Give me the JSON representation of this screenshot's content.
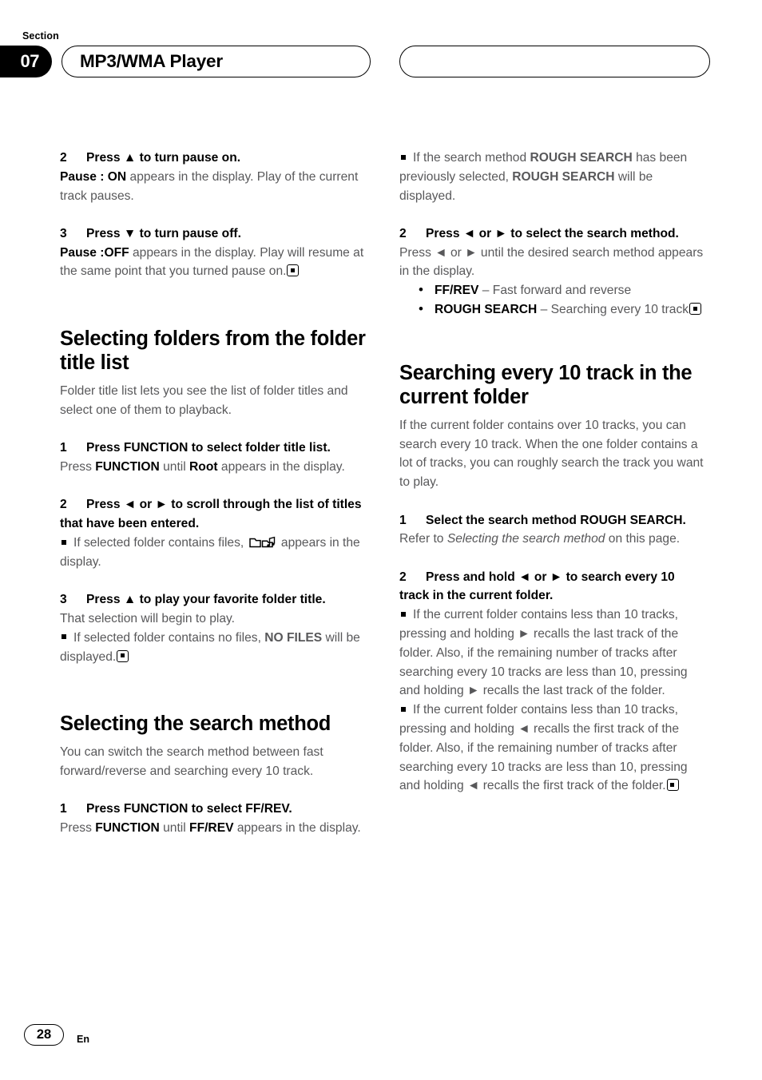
{
  "header": {
    "section_label": "Section",
    "section_number": "07",
    "title": "MP3/WMA Player",
    "right_pill_title": ""
  },
  "footer": {
    "page_number": "28",
    "language": "En"
  },
  "left_column": {
    "step2": {
      "num": "2",
      "title": "Press ▲ to turn pause on.",
      "body_bold": "Pause : ON",
      "body_rest": " appears in the display. Play of the current track pauses."
    },
    "step3": {
      "num": "3",
      "title": "Press ▼ to turn pause off.",
      "body_bold": "Pause :OFF",
      "body_rest": " appears in the display. Play will resume at the same point that you turned pause on."
    },
    "heading_folders": "Selecting folders from the folder title list",
    "folders_intro": "Folder title list lets you see the list of folder titles and select one of them to playback.",
    "folders_step1": {
      "num": "1",
      "title": "Press FUNCTION to select folder title list.",
      "body_pre": "Press ",
      "body_b1": "FUNCTION",
      "body_mid": " until ",
      "body_b2": "Root",
      "body_post": " appears in the display."
    },
    "folders_step2": {
      "num": "2",
      "title": "Press ◄ or ► to scroll through the list of titles that have been entered.",
      "note_pre": "If selected folder contains files, ",
      "note_post": " appears in the display."
    },
    "folders_step3": {
      "num": "3",
      "title": "Press ▲ to play your favorite folder title.",
      "body": "That selection will begin to play.",
      "note_pre": "If selected folder contains no files, ",
      "note_bold": "NO FILES",
      "note_post": " will be displayed."
    },
    "heading_search_method": "Selecting the search method",
    "search_method_intro": "You can switch the search method between fast forward/reverse and searching every 10 track.",
    "search_step1": {
      "num": "1",
      "title": "Press FUNCTION to select FF/REV.",
      "body_pre": "Press ",
      "body_b1": "FUNCTION",
      "body_mid": " until ",
      "body_b2": "FF/REV",
      "body_post": " appears in the display."
    }
  },
  "right_column": {
    "note_rough": {
      "pre": "If the search method ",
      "b1": "ROUGH SEARCH",
      "mid": " has been previously selected, ",
      "b2": "ROUGH SEARCH",
      "post": " will be displayed."
    },
    "search_step2": {
      "num": "2",
      "title": "Press ◄ or ► to select the search method.",
      "body": "Press ◄ or ► until the desired search method appears in the display."
    },
    "method_options": [
      {
        "bold": "FF/REV",
        "dash": " – ",
        "text": "Fast forward and reverse",
        "endmark": false
      },
      {
        "bold": "ROUGH SEARCH",
        "dash": " – ",
        "text": "Searching every 10 track",
        "endmark": true
      }
    ],
    "heading_searching": "Searching every 10 track in the current folder",
    "searching_intro": "If the current folder contains over 10 tracks, you can search every 10 track. When the one folder contains a lot of tracks, you can roughly search the track you want to play.",
    "searching_step1": {
      "num": "1",
      "title": "Select the search method ROUGH SEARCH.",
      "body_pre": "Refer to ",
      "body_italic": "Selecting the search method",
      "body_post": " on this page."
    },
    "searching_step2": {
      "num": "2",
      "title": "Press and hold ◄ or ► to search every 10 track in the current folder.",
      "note1": "If the current folder contains less than 10 tracks, pressing and holding ► recalls the last track of the folder. Also, if the remaining number of tracks after searching every 10 tracks are less than 10, pressing and holding ► recalls the last track of the folder.",
      "note2": "If the current folder contains less than 10 tracks, pressing and holding ◄ recalls the first track of the folder. Also, if the remaining number of tracks after searching every 10 tracks are less than 10, pressing and holding ◄ recalls the first track of the folder."
    }
  }
}
